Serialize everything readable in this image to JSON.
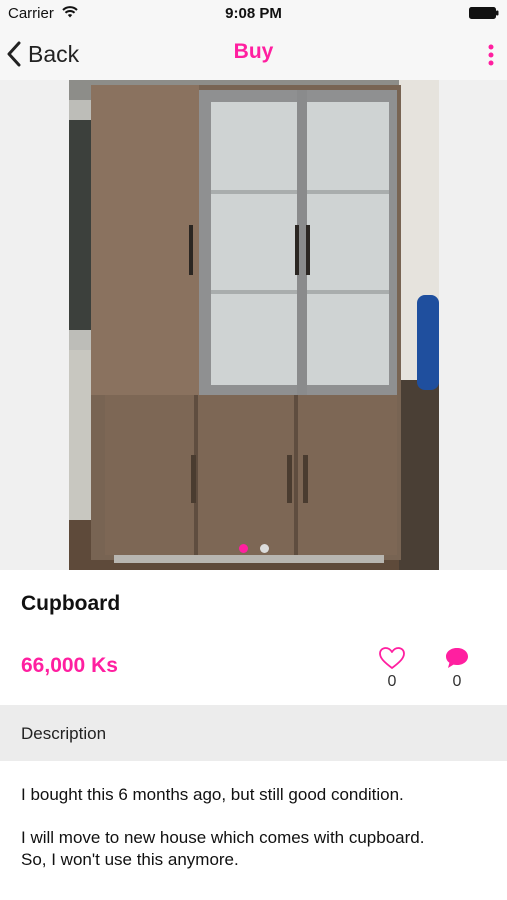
{
  "status_bar": {
    "carrier": "Carrier",
    "time": "9:08 PM"
  },
  "nav": {
    "back_label": "Back",
    "title": "Buy"
  },
  "gallery": {
    "photo_count": 2,
    "active_index": 0
  },
  "product": {
    "title": "Cupboard",
    "price": "66,000 Ks",
    "likes": "0",
    "comments": "0"
  },
  "description": {
    "header": "Description",
    "paragraph1": "I bought this 6 months ago, but still good condition.",
    "line2a": "I will move to new house which comes with cupboard.",
    "line2b": "So, I won't use this anymore."
  },
  "colors": {
    "accent": "#ff1fa0",
    "section_bg": "#ececec"
  }
}
